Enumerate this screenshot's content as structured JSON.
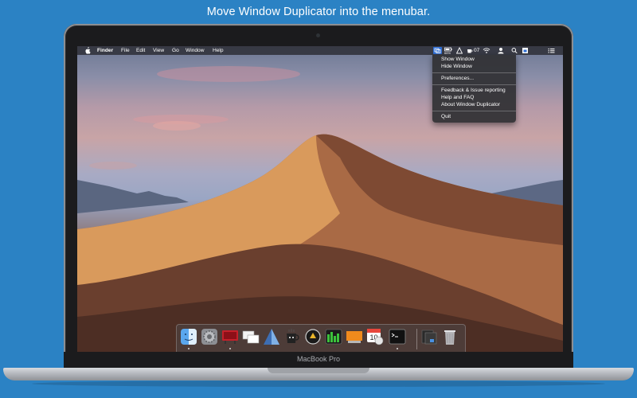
{
  "headline": "Move Window Duplicator into the menubar.",
  "device_label": "MacBook Pro",
  "menubar": {
    "apple_icon": "apple-icon",
    "app_name": "Finder",
    "menus": [
      "File",
      "Edit",
      "View",
      "Go",
      "Window",
      "Help"
    ],
    "battery_percent": "66%",
    "extra_value": "07"
  },
  "dropdown": {
    "items": [
      "Show Window",
      "Hide Window",
      "Preferences...",
      "Feedback & Issue reporting",
      "Help and FAQ",
      "About Window Duplicator",
      "Quit"
    ]
  },
  "dock": {
    "calendar_day": "10",
    "icons": [
      "finder-icon",
      "system-preferences-icon",
      "app-red-icon",
      "windows-icon",
      "delta-icon",
      "coffee-icon",
      "arrow-circle-icon",
      "activity-monitor-icon",
      "orange-app-icon",
      "calendar-icon",
      "terminal-icon",
      "window-stack-icon",
      "trash-icon"
    ]
  },
  "colors": {
    "background": "#2b82c4",
    "menu_highlight": "#2f6fd6"
  }
}
